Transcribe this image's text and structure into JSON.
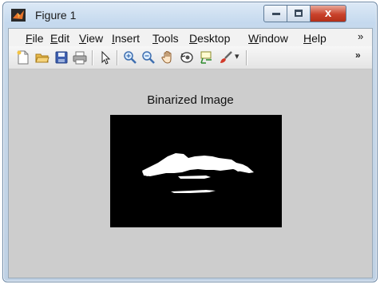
{
  "window": {
    "title": "Figure 1",
    "controls": {
      "minimize": "",
      "maximize": "",
      "close": "x"
    }
  },
  "menubar": {
    "items": [
      {
        "label": "File"
      },
      {
        "label": "Edit"
      },
      {
        "label": "View"
      },
      {
        "label": "Insert"
      },
      {
        "label": "Tools"
      },
      {
        "label": "Desktop"
      },
      {
        "label": "Window"
      },
      {
        "label": "Help"
      }
    ],
    "overflow": "»"
  },
  "toolbar": {
    "icons": [
      "new-figure-icon",
      "open-file-icon",
      "save-icon",
      "print-icon",
      "select-arrow-icon",
      "zoom-in-icon",
      "zoom-out-icon",
      "pan-icon",
      "rotate-3d-icon",
      "data-cursor-icon",
      "brush-icon"
    ],
    "overflow": "»",
    "brush_dropdown": "▾"
  },
  "figure": {
    "title": "Binarized Image",
    "background": "#000000",
    "foreground": "#ffffff"
  }
}
